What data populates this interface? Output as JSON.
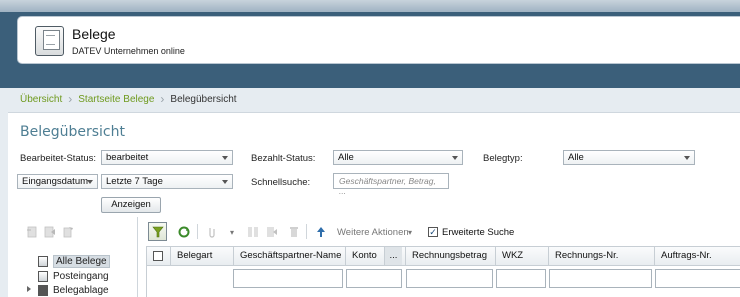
{
  "header": {
    "title": "Belege",
    "subtitle": "DATEV Unternehmen online"
  },
  "breadcrumb": {
    "items": [
      "Übersicht",
      "Startseite Belege"
    ],
    "current": "Belegübersicht"
  },
  "page": {
    "title": "Belegübersicht"
  },
  "filters": {
    "bearbeitet_label": "Bearbeitet-Status:",
    "bearbeitet_value": "bearbeitet",
    "bezahlt_label": "Bezahlt-Status:",
    "bezahlt_value": "Alle",
    "belegtyp_label": "Belegtyp:",
    "belegtyp_value": "Alle",
    "date_field_value": "Eingangsdatum",
    "date_range_value": "Letzte 7 Tage",
    "schnellsuche_label": "Schnellsuche:",
    "schnellsuche_placeholder": "Geschäftspartner, Betrag, ...",
    "show_button": "Anzeigen"
  },
  "tree": {
    "items": [
      "Alle Belege",
      "Posteingang",
      "Belegablage"
    ]
  },
  "grid_toolbar": {
    "more_actions": "Weitere Aktionen",
    "extended_search": "Erweiterte Suche",
    "extended_search_checked": "✓"
  },
  "grid": {
    "columns": [
      "Belegart",
      "Geschäftspartner-Name",
      "Konto",
      "Rechnungsbetrag",
      "WKZ",
      "Rechnungs-Nr.",
      "Auftrags-Nr."
    ],
    "konto_menu": "..."
  },
  "colors": {
    "accent_green": "#6f9a1e",
    "title_blue": "#4e7e93",
    "frame": "#3b5f7a"
  }
}
